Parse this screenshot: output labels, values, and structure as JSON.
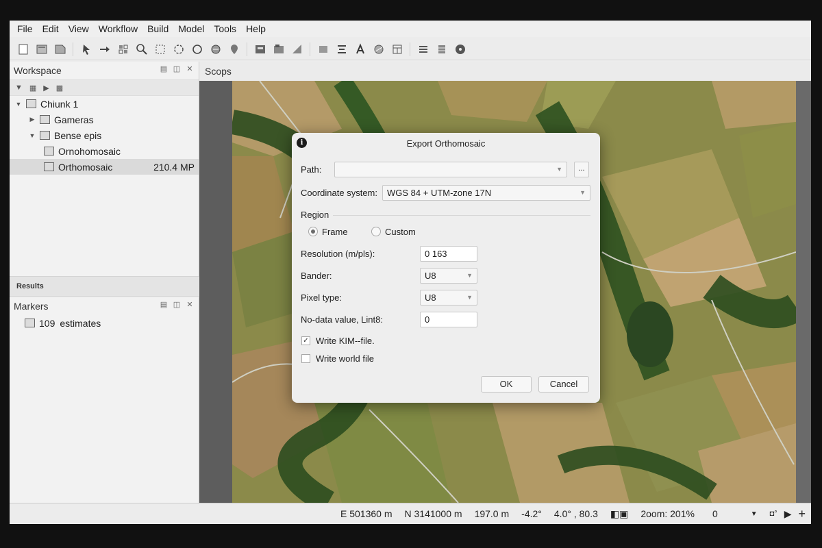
{
  "menu": [
    "File",
    "Edit",
    "View",
    "Workflow",
    "Build",
    "Model",
    "Tools",
    "Help"
  ],
  "toolbar_icons": [
    "new-file-icon",
    "open-icon",
    "save-icon",
    "select-arrow-icon",
    "move-icon",
    "region-icon",
    "zoom-icon",
    "rect-select-icon",
    "circle-select-icon",
    "free-select-icon",
    "rotate-icon",
    "marker-icon",
    "image-icon",
    "export-icon",
    "ruler-icon",
    "shape-icon",
    "dense-icon",
    "text-icon",
    "globe-icon",
    "grid-icon",
    "layer-icon",
    "table-icon",
    "settings-icon"
  ],
  "workspace": {
    "title": "Workspace",
    "chunk": "Chiunk 1",
    "cameras": "Gameras",
    "dense": "Bense epis",
    "ortho_child": "Ornohomosaic",
    "ortho_selected": "Orthomosaic",
    "ortho_size": "210.4 MP"
  },
  "results_label": "Results",
  "markers": {
    "title": "Markers",
    "count": "109",
    "item_label": "estimates"
  },
  "viewport": {
    "tab": "Scops"
  },
  "status": {
    "easting": "E 501360 m",
    "northing": "N 3141000 m",
    "altitude": "197.0 m",
    "angle": "-4.2°",
    "rotation": "4.0° , 80.3",
    "zoom": "2oom: 201%",
    "value": "0"
  },
  "dialog": {
    "title": "Export Orthomosaic",
    "path_label": "Path:",
    "path_value": "",
    "browse_label": "...",
    "crs_label": "Coordinate system:",
    "crs_value": "WGS 84 + UTM-zone 17N",
    "region_label": "Region",
    "frame_label": "Frame",
    "custom_label": "Custom",
    "region_selected": "Frame",
    "resolution_label": "Resolution (m/pls):",
    "resolution_value": "0 163",
    "bander_label": "Bander:",
    "bander_value": "U8",
    "pixel_label": "Pixel type:",
    "pixel_value": "U8",
    "nodata_label": "No-data value, Lint8:",
    "nodata_value": "0",
    "kml_label": "Write KIM--file.",
    "kml_checked": true,
    "world_label": "Write world file",
    "world_checked": false,
    "ok_label": "OK",
    "cancel_label": "Cancel"
  }
}
